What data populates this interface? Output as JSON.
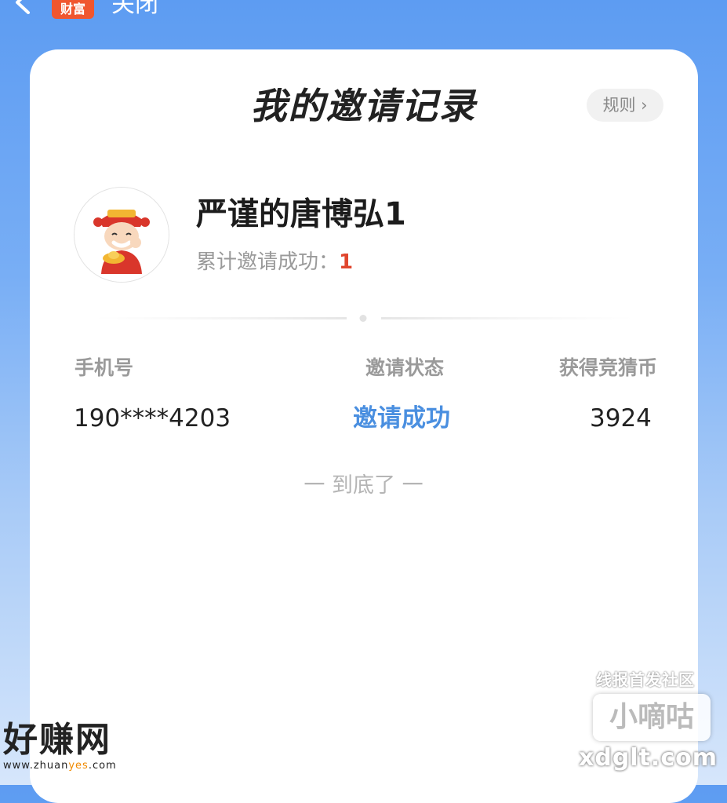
{
  "topbar": {
    "app_badge": "财富",
    "close_label": "关闭"
  },
  "card": {
    "title": "我的邀请记录",
    "rules_label": "规则 ›"
  },
  "profile": {
    "username": "严谨的唐博弘1",
    "stat_label": "累计邀请成功：",
    "stat_value": "1"
  },
  "table": {
    "headers": [
      "手机号",
      "邀请状态",
      "获得竞猜币"
    ],
    "rows": [
      {
        "phone": "190****4203",
        "status": "邀请成功",
        "coins": "3924"
      }
    ]
  },
  "end_text": "一 到底了 一",
  "colors": {
    "accent_blue": "#4a8fe0",
    "stat_red": "#e0462e",
    "badge_orange": "#f0562f"
  },
  "watermarks": {
    "left_big": "好赚网",
    "left_small_prefix": "www.zhuan",
    "left_small_yes": "yes",
    "left_small_suffix": ".com",
    "right_top": "线报首发社区",
    "right_box": "小嘀咕",
    "right_url": "xdglt.com"
  },
  "icons": {
    "back": "chevron-left-icon",
    "avatar": "fortune-god-avatar"
  }
}
